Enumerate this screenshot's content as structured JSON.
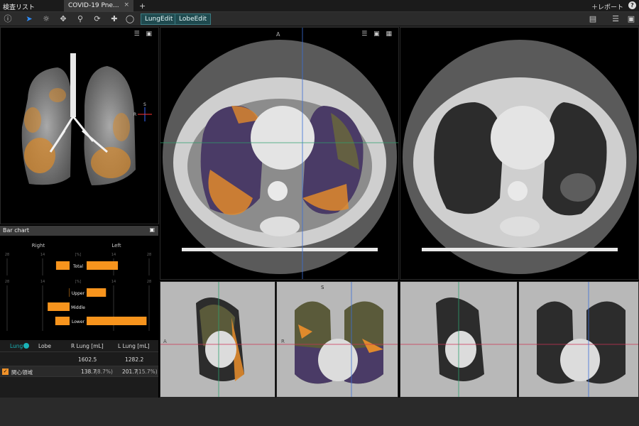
{
  "header": {
    "app_title": "検査リスト",
    "tab_label": "COVID-19 Pne...",
    "tab_close": "×",
    "new_tab": "+",
    "report_label": "＋レポート",
    "help": "?"
  },
  "toolbar": {
    "lungedit_label": "LungEdit",
    "lobeedit_label": "LobeEdit"
  },
  "viewer": {
    "orientation_top": "A",
    "orientation_left": "A",
    "orientation_r": "R",
    "orientation_s": "S",
    "orientation_x": "X",
    "orientation_s_small": "S",
    "orientation_r_small": "R"
  },
  "bar_chart": {
    "title": "Bar chart",
    "right_label": "Right",
    "left_label": "Left",
    "unit": "[%]",
    "ticks": [
      "28",
      "14",
      "14",
      "28"
    ],
    "rows_total": [
      "Total"
    ],
    "rows_lobe": [
      "Upper",
      "Middle",
      "Lower"
    ]
  },
  "chart_data": {
    "type": "bar",
    "groups": [
      {
        "categories": [
          "Total"
        ],
        "right": [
          8.7
        ],
        "left": [
          15.7
        ]
      },
      {
        "categories": [
          "Upper",
          "Middle",
          "Lower"
        ],
        "right": [
          3.5,
          12,
          9
        ],
        "left": [
          11,
          0,
          27
        ]
      }
    ],
    "xlim": [
      28,
      28
    ],
    "xlabel": "[%]",
    "series": [
      {
        "name": "Right",
        "side": "left"
      },
      {
        "name": "Left",
        "side": "right"
      }
    ],
    "bar_color": "#f7941d"
  },
  "table": {
    "tab_lung": "Lung",
    "tab_lobe": "Lobe",
    "col_r": "R Lung [mL]",
    "col_l": "L Lung [mL]",
    "r_total": "1602.5",
    "l_total": "1282.2",
    "roi_label": "関心領域",
    "roi_r": "138.7",
    "roi_r_pct": "(8.7%)",
    "roi_l": "201.7",
    "roi_l_pct": "(15.7%)"
  },
  "colors": {
    "accent": "#19b4b8",
    "orange": "#f7941d",
    "purple": "#5b4a7d"
  }
}
